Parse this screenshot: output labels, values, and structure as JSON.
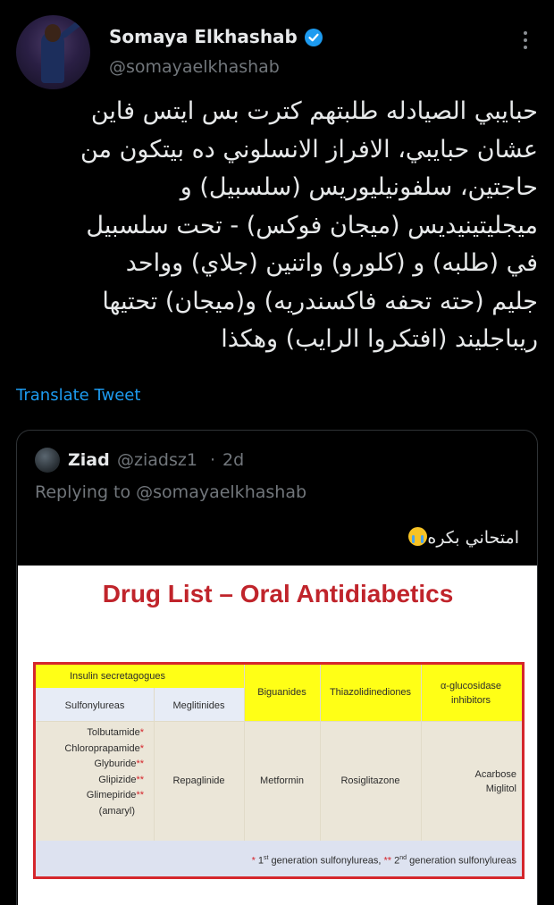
{
  "author": {
    "name": "Somaya Elkhashab",
    "handle": "@somayaelkhashab",
    "verified": true
  },
  "tweet": {
    "lines": [
      "حبايبي الصيادله طلبتهم كترت بس ايتس فاين",
      "عشان حبايبي، الافراز الانسلوني ده بيتكون من",
      "حاجتين، سلفونيليوريس (سلسبيل) و",
      "ميجليتينيديس (ميجان فوكس) - تحت سلسبيل",
      "في (طلبه) و (كلورو) واتنين (جلاي) وواحد",
      "جليم (حته تحفه فاكسندريه) و(ميجان) تحتيها",
      "ريباجليند (افتكروا الرايب) وهكذا"
    ],
    "translate_label": "Translate Tweet"
  },
  "quoted": {
    "name": "Ziad",
    "handle": "@ziadsz1",
    "separator": "·",
    "time": "2d",
    "replying_to": "Replying to @somayaelkhashab",
    "text": "امتحاني بكره",
    "emoji": "crying-face-emoji",
    "image": {
      "title": "Drug List – Oral Antidiabetics",
      "header_group": "Insulin secretagogues",
      "columns": [
        "Sulfonylureas",
        "Meglitinides",
        "Biguanides",
        "Thiazolidinediones",
        "α-glucosidase inhibitors"
      ],
      "sulfonylureas": [
        {
          "name": "Tolbutamide",
          "mark": "*"
        },
        {
          "name": "Chloroprapamide",
          "mark": "*"
        },
        {
          "name": "Glyburide",
          "mark": "**"
        },
        {
          "name": "Glipizide",
          "mark": "**"
        },
        {
          "name": "Glimepiride",
          "mark": "**"
        },
        {
          "name": "(amaryl)",
          "mark": ""
        }
      ],
      "meglitinides": "Repaglinide",
      "biguanides": "Metformin",
      "thiazolidinediones": "Rosiglitazone",
      "agi": [
        "Acarbose",
        "Miglitol"
      ],
      "footnote": {
        "star1": "*",
        "first": "1",
        "first_sup": "st",
        "first_text": " generation sulfonylureas, ",
        "star2": "**",
        "second": " 2",
        "second_sup": "nd",
        "second_text": " generation sulfonylureas"
      },
      "colors": {
        "border": "#d5262c",
        "header": "#ffff16",
        "title": "#c0242b"
      }
    }
  },
  "colors": {
    "background": "#000000",
    "link": "#1d9bf0",
    "muted": "#71767b"
  }
}
